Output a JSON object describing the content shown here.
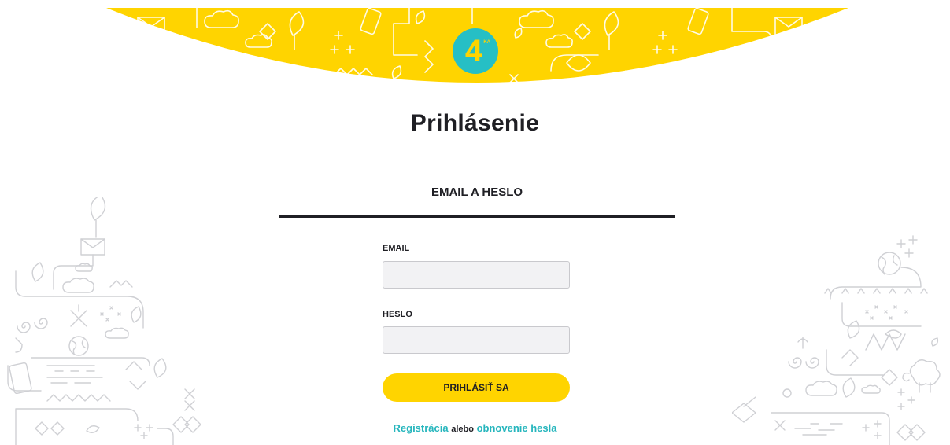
{
  "header": {
    "logo_text": "4",
    "logo_superscript": "KA"
  },
  "page": {
    "title": "Prihlásenie"
  },
  "login_tab": {
    "label": "EMAIL A HESLO"
  },
  "form": {
    "email_label": "EMAIL",
    "email_value": "",
    "password_label": "HESLO",
    "password_value": "",
    "submit_label": "PRIHLÁSIŤ SA"
  },
  "footer_links": {
    "register": "Registrácia",
    "separator": "alebo",
    "reset": "obnovenie hesla"
  },
  "colors": {
    "brand_yellow": "#ffd400",
    "brand_teal": "#26bfc5",
    "text_dark": "#1f1f24",
    "input_bg": "#f2f2f4"
  },
  "icons": [
    "leaf-icon",
    "envelope-icon",
    "cloud-icon",
    "phone-icon",
    "globe-icon",
    "spiral-icon",
    "sheep-icon",
    "plus-icon"
  ]
}
